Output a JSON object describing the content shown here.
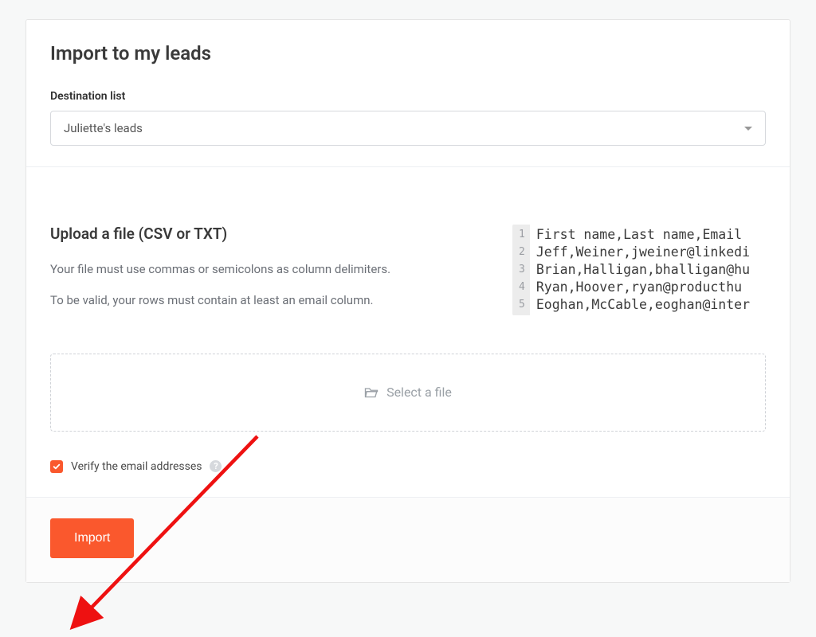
{
  "header": {
    "title": "Import to my leads",
    "destination_label": "Destination list",
    "destination_value": "Juliette's leads"
  },
  "upload": {
    "title": "Upload a file (CSV or TXT)",
    "help_line1": "Your file must use commas or semicolons as column delimiters.",
    "help_line2": "To be valid, your rows must contain at least an email column.",
    "dropzone_label": "Select a file"
  },
  "csv_preview": {
    "lines": [
      "First name,Last name,Email",
      "Jeff,Weiner,jweiner@linkedi",
      "Brian,Halligan,bhalligan@hu",
      "Ryan,Hoover,ryan@producthu",
      "Eoghan,McCable,eoghan@inter"
    ]
  },
  "verify": {
    "label": "Verify the email addresses",
    "checked": true
  },
  "footer": {
    "import_label": "Import"
  },
  "annotation": {
    "arrow_target": "verify-checkbox"
  }
}
